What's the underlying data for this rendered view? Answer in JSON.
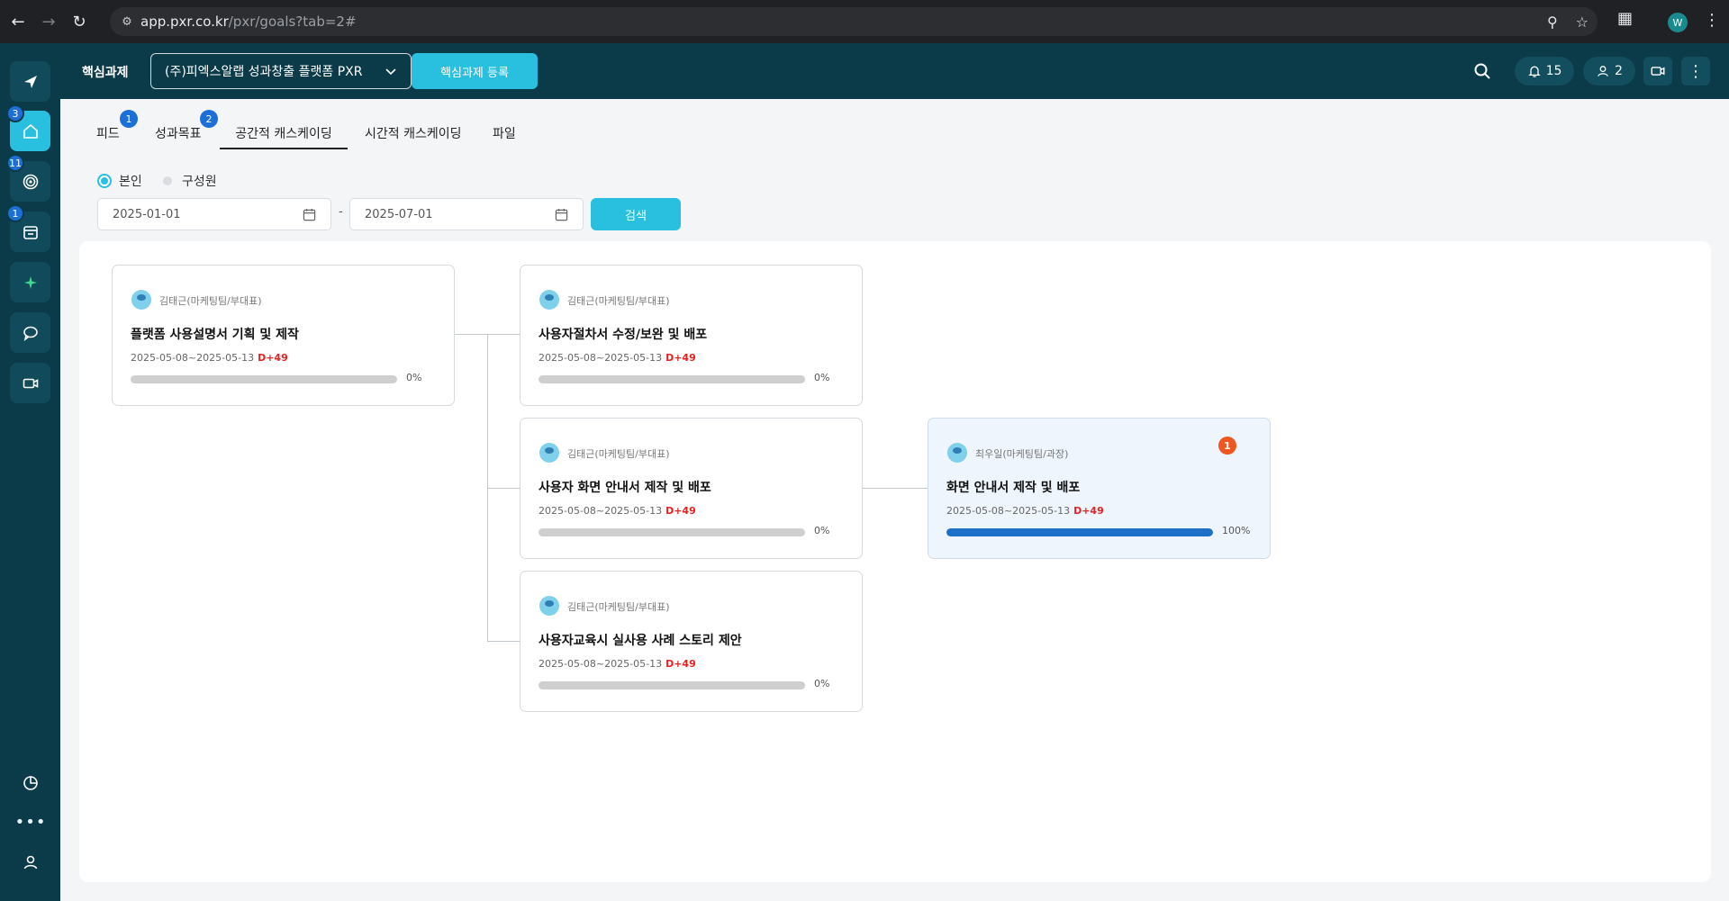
{
  "browser": {
    "url_host": "app.pxr.co.kr",
    "url_path": "/pxr/goals?tab=2#",
    "profile_initial": "W"
  },
  "sidebar": {
    "items": [
      {
        "name": "launch",
        "icon": "rocket-icon",
        "badge": ""
      },
      {
        "name": "home",
        "icon": "home-icon",
        "badge": "3",
        "active": true
      },
      {
        "name": "goals",
        "icon": "target-icon",
        "badge": "11"
      },
      {
        "name": "schedule",
        "icon": "calendar-edit-icon",
        "badge": "1"
      },
      {
        "name": "ai",
        "icon": "sparkle-icon",
        "badge": ""
      },
      {
        "name": "chat",
        "icon": "chat-icon",
        "badge": ""
      },
      {
        "name": "video",
        "icon": "video-icon",
        "badge": ""
      }
    ]
  },
  "header": {
    "title": "핵심과제",
    "company_select": "(주)피엑스알랩 성과창출 플랫폼 PXR",
    "register_button": "핵심과제 등록",
    "notifications_count": "15",
    "users_count": "2"
  },
  "tabs": [
    {
      "label": "피드",
      "badge": "1"
    },
    {
      "label": "성과목표",
      "badge": "2"
    },
    {
      "label": "공간적 캐스케이딩",
      "badge": "",
      "active": true
    },
    {
      "label": "시간적 캐스케이딩",
      "badge": ""
    },
    {
      "label": "파일",
      "badge": ""
    }
  ],
  "filter": {
    "radio_self": "본인",
    "radio_members": "구성원",
    "date_from": "2025-01-01",
    "date_to": "2025-07-01",
    "search_button": "검색"
  },
  "cards": [
    {
      "owner": "김태근(마케팅팀/부대표)",
      "title": "플랫폼 사용설명서 기획 및 제작",
      "period": "2025-05-08~2025-05-13",
      "dday": "D+49",
      "progress": 0,
      "progress_label": "0%"
    },
    {
      "owner": "김태근(마케팅팀/부대표)",
      "title": "사용자절차서 수정/보완 및 배포",
      "period": "2025-05-08~2025-05-13",
      "dday": "D+49",
      "progress": 0,
      "progress_label": "0%"
    },
    {
      "owner": "김태근(마케팅팀/부대표)",
      "title": "사용자 화면 안내서 제작 및 배포",
      "period": "2025-05-08~2025-05-13",
      "dday": "D+49",
      "progress": 0,
      "progress_label": "0%"
    },
    {
      "owner": "김태근(마케팅팀/부대표)",
      "title": "사용자교육시 실사용 사례 스토리 제안",
      "period": "2025-05-08~2025-05-13",
      "dday": "D+49",
      "progress": 0,
      "progress_label": "0%"
    },
    {
      "owner": "최우일(마케팅팀/과장)",
      "title": "화면 안내서 제작 및 배포",
      "period": "2025-05-08~2025-05-13",
      "dday": "D+49",
      "progress": 100,
      "progress_label": "100%",
      "badge": "1"
    }
  ]
}
